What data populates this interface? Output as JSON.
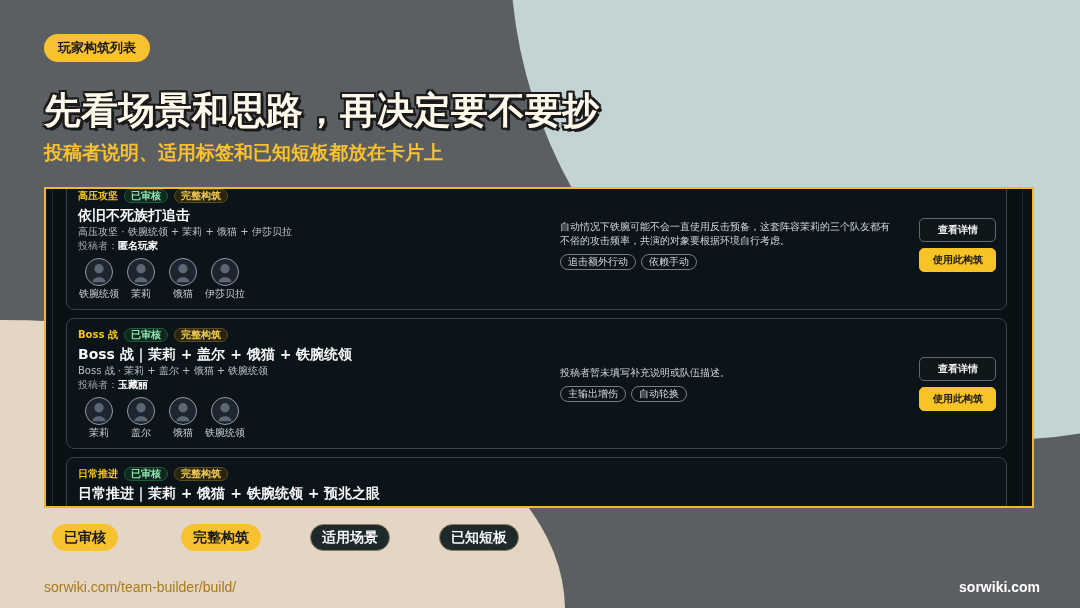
{
  "header": {
    "badge": "玩家构筑列表",
    "title": "先看场景和思路，再决定要不要抄",
    "subtitle": "投稿者说明、适用标签和已知短板都放在卡片上"
  },
  "builds": [
    {
      "scene": "高压攻坚",
      "badges": [
        {
          "label": "已审核",
          "kind": "approved"
        },
        {
          "label": "完整构筑",
          "kind": "complete"
        }
      ],
      "title": "依旧不死族打追击",
      "summary": "高压攻坚 · 铁腕统领 + 茉莉 + 饿猫 + 伊莎贝拉",
      "author": "投稿者：**匿名玩家**",
      "members": [
        "铁腕统领",
        "茉莉",
        "饿猫",
        "伊莎贝拉"
      ],
      "description": "自动情况下铁腕可能不会一直使用反击预备，这套阵容茉莉的三个队友都有不俗的攻击频率，共演的对象要根据环境自行考虑。",
      "tags": [
        "追击额外行动",
        "依赖手动"
      ],
      "buttons": [
        {
          "label": "查看详情",
          "kind": "secondary"
        },
        {
          "label": "使用此构筑",
          "kind": "primary"
        }
      ]
    },
    {
      "scene": "Boss 战",
      "badges": [
        {
          "label": "已审核",
          "kind": "approved"
        },
        {
          "label": "完整构筑",
          "kind": "complete"
        }
      ],
      "title": "Boss 战｜茉莉 + 盖尔 + 饿猫 + 铁腕统领",
      "summary": "Boss 战 · 茉莉 + 盖尔 + 饿猫 + 铁腕统领",
      "author": "投稿者：**玉藏丽**",
      "members": [
        "茉莉",
        "盖尔",
        "饿猫",
        "铁腕统领"
      ],
      "description": "投稿者暂未填写补充说明或队伍描述。",
      "tags": [
        "主输出增伤",
        "自动轮换"
      ],
      "buttons": [
        {
          "label": "查看详情",
          "kind": "secondary"
        },
        {
          "label": "使用此构筑",
          "kind": "primary"
        }
      ]
    },
    {
      "scene": "日常推进",
      "badges": [
        {
          "label": "已审核",
          "kind": "approved"
        },
        {
          "label": "完整构筑",
          "kind": "complete"
        }
      ],
      "title": "日常推进｜茉莉 + 饿猫 + 铁腕统领 + 预兆之眼"
    }
  ],
  "legend": [
    {
      "label": "已审核",
      "kind": "accent"
    },
    {
      "label": "完整构筑",
      "kind": "accent"
    },
    {
      "label": "适用场景",
      "kind": "dark"
    },
    {
      "label": "已知短板",
      "kind": "dark"
    }
  ],
  "footer": {
    "url": "sorwiki.com/team-builder/build/",
    "brand": "sorwiki.com"
  }
}
